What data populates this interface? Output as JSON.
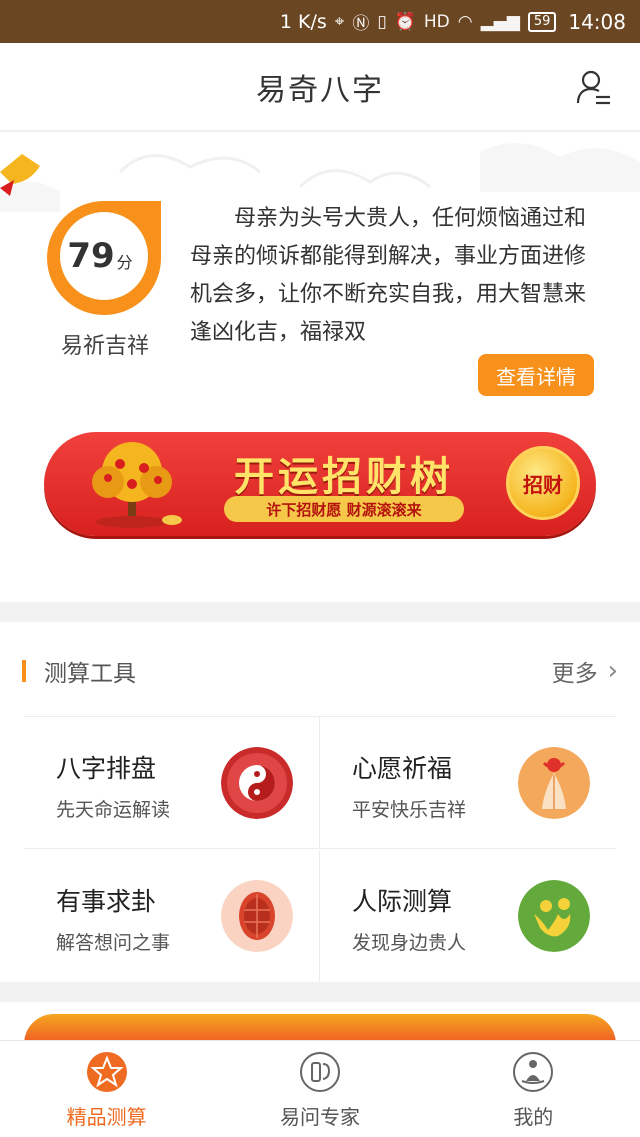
{
  "status_bar": {
    "speed": "1 K/s",
    "battery": "59",
    "time": "14:08"
  },
  "header": {
    "title": "易奇八字"
  },
  "fortune": {
    "score": "79",
    "score_unit": "分",
    "score_fraction": 0.79,
    "score_label": "易祈吉祥",
    "text": "母亲为头号大贵人，任何烦恼通过和母亲的倾诉都能得到解决，事业方面进修机会多，让你不断充实自我，用大智慧来逢凶化吉，福禄双",
    "detail_button": "查看详情"
  },
  "banner": {
    "title": "开运招财树",
    "subtitle": "许下招财愿 财源滚滚来",
    "coin_label": "招财"
  },
  "tools": {
    "section_title": "测算工具",
    "more": "更多",
    "items": [
      {
        "title": "八字排盘",
        "subtitle": "先天命运解读",
        "icon": "yin-yang-icon"
      },
      {
        "title": "心愿祈福",
        "subtitle": "平安快乐吉祥",
        "icon": "praying-hands-icon"
      },
      {
        "title": "有事求卦",
        "subtitle": "解答想问之事",
        "icon": "turtle-shell-icon"
      },
      {
        "title": "人际测算",
        "subtitle": "发现身边贵人",
        "icon": "people-icon"
      }
    ]
  },
  "tabbar": {
    "tabs": [
      {
        "label": "精品测算",
        "icon": "star-compass-icon",
        "active": true
      },
      {
        "label": "易问专家",
        "icon": "expert-icon",
        "active": false
      },
      {
        "label": "我的",
        "icon": "meditation-icon",
        "active": false
      }
    ]
  },
  "colors": {
    "status_bar": "#6b4623",
    "accent": "#f7911c",
    "active_tab": "#ef6b21",
    "banner_red": "#e0302b"
  }
}
